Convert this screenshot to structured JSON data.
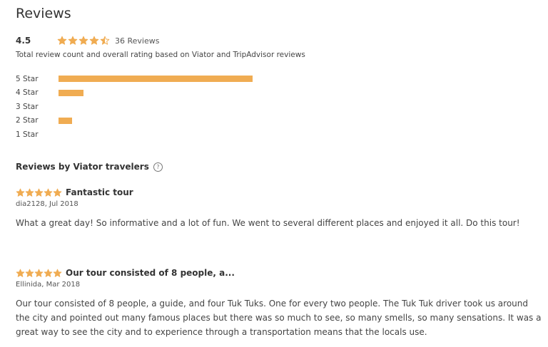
{
  "header": {
    "title": "Reviews"
  },
  "summary": {
    "rating": "4.5",
    "stars": 4.5,
    "review_count_label": "36 Reviews",
    "note": "Total review count and overall rating based on Viator and TripAdvisor reviews"
  },
  "breakdown": [
    {
      "label": "5 Star",
      "fraction": 1.0
    },
    {
      "label": "4 Star",
      "fraction": 0.13
    },
    {
      "label": "3 Star",
      "fraction": 0
    },
    {
      "label": "2 Star",
      "fraction": 0.07
    },
    {
      "label": "1 Star",
      "fraction": 0
    }
  ],
  "viator_section": {
    "heading": "Reviews by Viator travelers",
    "help_icon": "question-circle-icon"
  },
  "reviews": [
    {
      "stars": 5,
      "title": "Fantastic tour",
      "meta": "dia2128, Jul 2018",
      "body": "What a great day! So informative and a lot of fun. We went to several different places and enjoyed it all. Do this tour!"
    },
    {
      "stars": 5,
      "title": "Our tour consisted of 8 people, a...",
      "meta": "Ellinida, Mar 2018",
      "body": "Our tour consisted of 8 people, a guide, and four Tuk Tuks. One for every two people. The Tuk Tuk driver took us around the city and pointed out many famous places but there was so much to see, so many smells, so many sensations. It was a great way to see the city and to experience through a transportation means that the locals use."
    }
  ],
  "colors": {
    "star": "#f0ac52",
    "bar": "#f0ac52"
  }
}
